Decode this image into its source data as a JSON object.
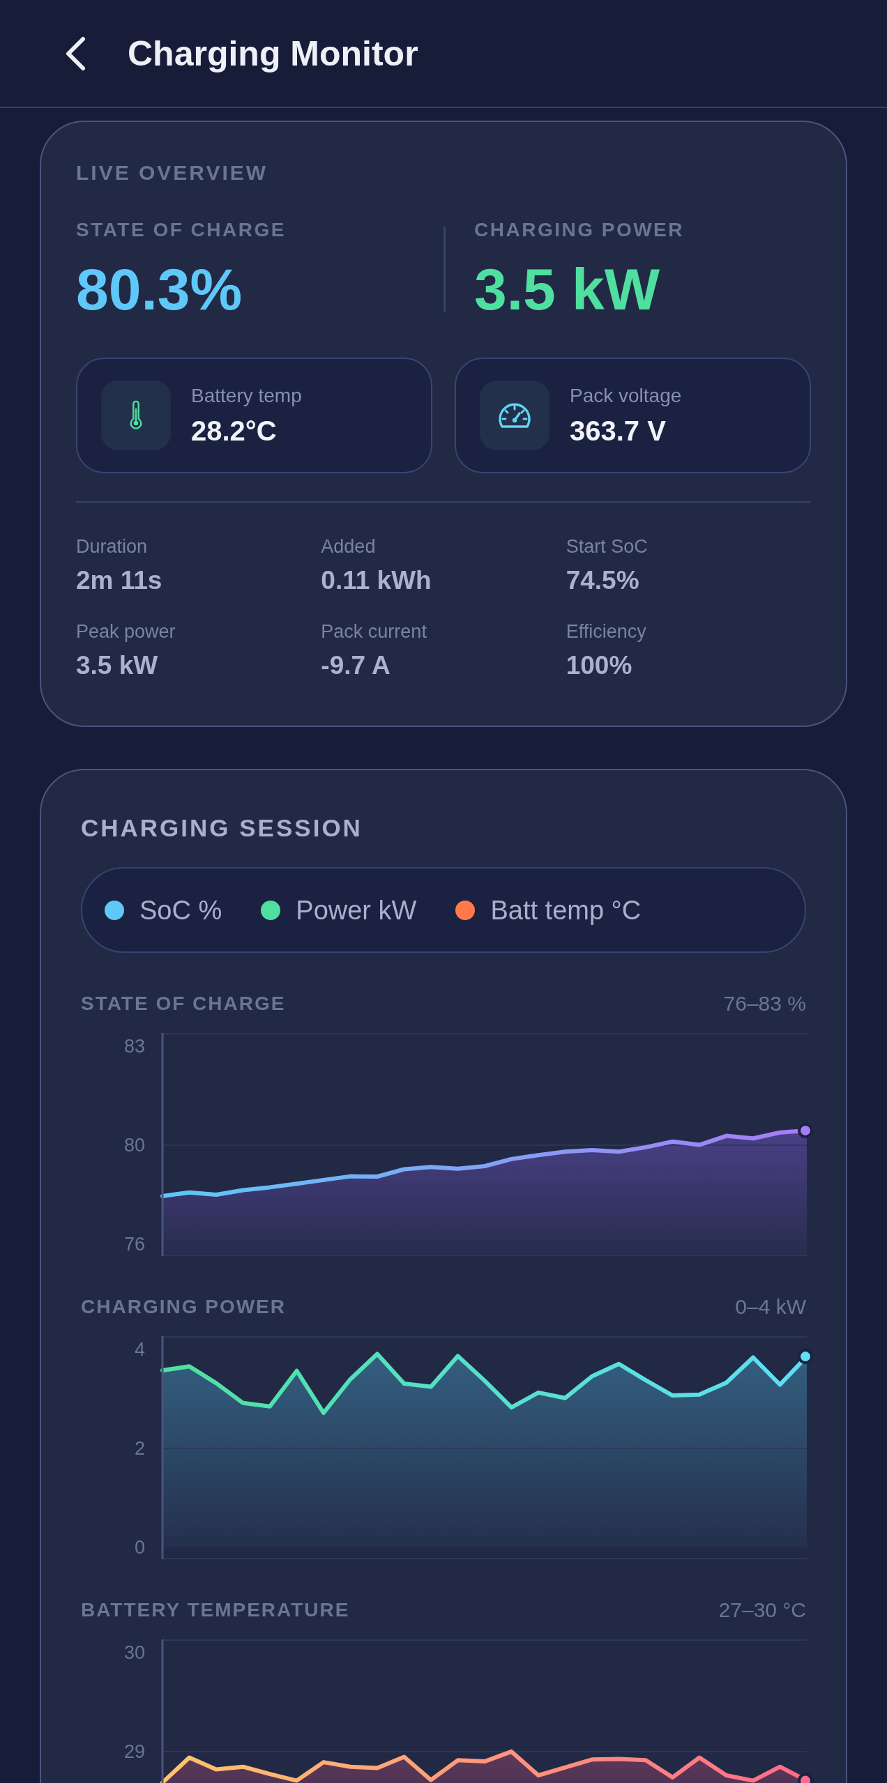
{
  "header": {
    "title": "Charging Monitor"
  },
  "overview": {
    "title": "LIVE OVERVIEW",
    "primary": [
      {
        "label": "STATE OF CHARGE",
        "value": "80.3%",
        "color": "#5ec8f8"
      },
      {
        "label": "CHARGING POWER",
        "value": "3.5 kW",
        "color": "#4fe0a0"
      }
    ],
    "metrics": [
      {
        "kind": "temperature",
        "label": "Battery temp",
        "value": "28.2°C"
      },
      {
        "kind": "voltage",
        "label": "Pack voltage",
        "value": "363.7 V"
      }
    ],
    "stats": [
      {
        "label": "Duration",
        "value": "2m 11s"
      },
      {
        "label": "Added",
        "value": "0.11 kWh"
      },
      {
        "label": "Start SoC",
        "value": "74.5%"
      },
      {
        "label": "Peak power",
        "value": "3.5 kW"
      },
      {
        "label": "Pack current",
        "value": "-9.7 A"
      },
      {
        "label": "Efficiency",
        "value": "100%"
      }
    ]
  },
  "session": {
    "title": "CHARGING SESSION",
    "legend": [
      {
        "label": "SoC %",
        "color": "#5ec8f8"
      },
      {
        "label": "Power kW",
        "color": "#4fe0a0"
      },
      {
        "label": "Batt temp °C",
        "color": "#ff7a48"
      }
    ],
    "charts": [
      {
        "range": "76–83 %",
        "chart_data": {
          "type": "area",
          "title": "STATE OF CHARGE",
          "ylim": [
            75.58,
            83.47
          ],
          "yticks": [
            83,
            {
              "value": 79.5,
              "label": "80"
            },
            76
          ],
          "ref_lines": [
            {
              "axis": "y",
              "value": 79.5
            }
          ],
          "series": [
            {
              "color": "#5ec8f8",
              "values": [
                77.7,
                77.83,
                77.75,
                77.91,
                78.01,
                78.14,
                78.27,
                78.4,
                78.39,
                78.65,
                78.73,
                78.67,
                78.76,
                79.01,
                79.15,
                79.27,
                79.33,
                79.27,
                79.43,
                79.63,
                79.51,
                79.83,
                79.74,
                79.95,
                80.02
              ]
            }
          ]
        }
      },
      {
        "range": "0–4 kW",
        "chart_data": {
          "type": "area",
          "title": "CHARGING POWER",
          "ylim": [
            -0.24,
            4.27
          ],
          "yticks": [
            4,
            2,
            0
          ],
          "ref_lines": [
            {
              "axis": "y",
              "value": 2
            }
          ],
          "series": [
            {
              "color": "#4fe0a0",
              "values": [
                3.58,
                3.66,
                3.32,
                2.92,
                2.85,
                3.57,
                2.72,
                3.4,
                3.91,
                3.31,
                3.25,
                3.87,
                3.37,
                2.83,
                3.13,
                3.02,
                3.46,
                3.71,
                3.38,
                3.07,
                3.09,
                3.33,
                3.84,
                3.29,
                3.86
              ]
            }
          ]
        }
      },
      {
        "range": "27–30 °C",
        "chart_data": {
          "type": "area",
          "title": "BATTERY TEMPERATURE",
          "ylim": [
            26.82,
            30.2
          ],
          "yticks": [
            30,
            {
              "value": 28.5,
              "label": "29"
            }
          ],
          "ref_lines": [
            {
              "axis": "y",
              "value": 28.5
            }
          ],
          "series": [
            {
              "color": "#ffc56b",
              "values": [
                28.03,
                28.41,
                28.23,
                28.27,
                28.16,
                28.06,
                28.34,
                28.27,
                28.25,
                28.42,
                28.07,
                28.37,
                28.35,
                28.5,
                28.14,
                28.26,
                28.38,
                28.39,
                28.37,
                28.11,
                28.41,
                28.14,
                28.06,
                28.27,
                28.06
              ]
            }
          ]
        }
      }
    ]
  }
}
